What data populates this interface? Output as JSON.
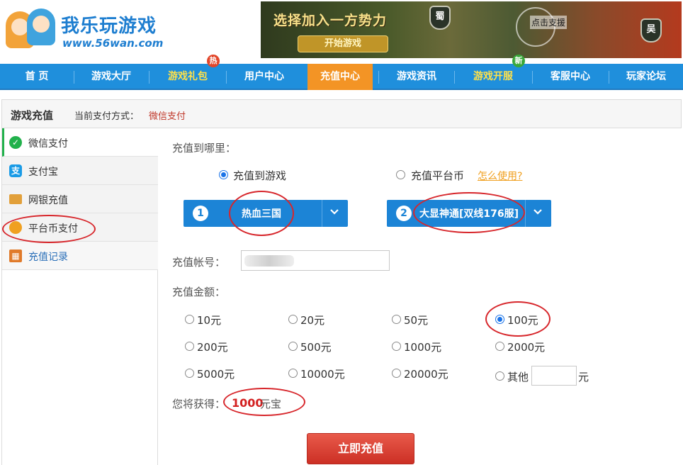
{
  "header": {
    "logo_title": "我乐玩游戏",
    "logo_url": "www.56wan.com",
    "banner": {
      "title": "选择加入一方势力",
      "button": "开始游戏",
      "shield_shu": "蜀",
      "shield_wu": "吴",
      "support": "点击支援"
    }
  },
  "nav": {
    "items": [
      {
        "label": "首 页"
      },
      {
        "label": "游戏大厅"
      },
      {
        "label": "游戏礼包"
      },
      {
        "label": "用户中心"
      },
      {
        "label": "充值中心"
      },
      {
        "label": "游戏资讯"
      },
      {
        "label": "游戏开服"
      },
      {
        "label": "客服中心"
      },
      {
        "label": "玩家论坛"
      }
    ],
    "active": "充值中心",
    "badges": {
      "hot": "热",
      "new": "新"
    }
  },
  "titlebar": {
    "title": "游戏充值",
    "method_label": "当前支付方式：",
    "method_value": "微信支付"
  },
  "sidebar": {
    "items": [
      {
        "label": "微信支付",
        "icon": "wechat-icon",
        "color": "#22b14c"
      },
      {
        "label": "支付宝",
        "icon": "alipay-icon",
        "color": "#1a9be6"
      },
      {
        "label": "网银充值",
        "icon": "bankcard-icon",
        "color": "#e2a03a"
      },
      {
        "label": "平台币支付",
        "icon": "coins-icon",
        "color": "#f0a020"
      },
      {
        "label": "充值记录",
        "icon": "record-icon",
        "color": "#e07a2a"
      }
    ]
  },
  "form": {
    "target_label": "充值到哪里：",
    "target_game": "充值到游戏",
    "target_platform": "充值平台币",
    "howto": "怎么使用?",
    "step1_num": "1",
    "game_name": "热血三国",
    "step2_num": "2",
    "server_name": "大显神通[双线176服]",
    "account_label": "充值帐号：",
    "amount_label": "充值金额：",
    "amounts": [
      "10元",
      "20元",
      "50元",
      "100元",
      "200元",
      "500元",
      "1000元",
      "2000元",
      "5000元",
      "10000元",
      "20000元"
    ],
    "selected_amount": "100元",
    "other_label": "其他",
    "other_unit": "元",
    "gain_label": "您将获得：",
    "gain_value": "1000",
    "gain_unit": "元宝",
    "submit": "立即充值"
  }
}
